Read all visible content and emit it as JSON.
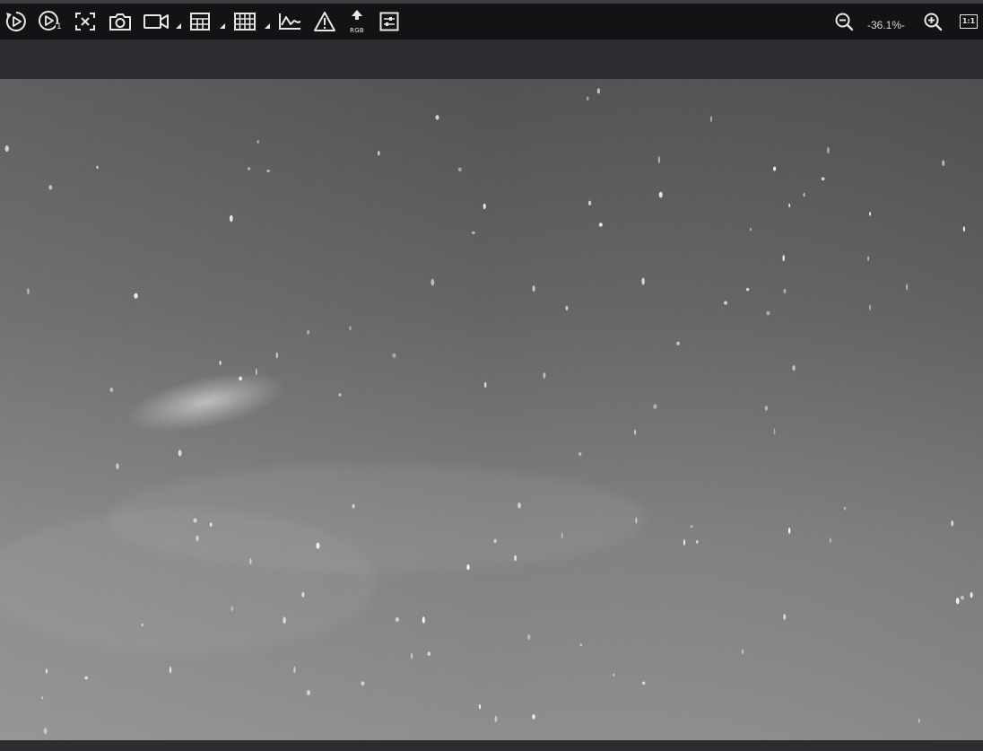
{
  "toolbar": {
    "tools": [
      {
        "name": "play-loop-icon"
      },
      {
        "name": "play-single-icon",
        "sub": "1"
      },
      {
        "name": "fit-view-icon"
      },
      {
        "name": "camera-snapshot-icon"
      },
      {
        "name": "video-record-icon"
      },
      {
        "name": "grid-small-icon"
      },
      {
        "name": "grid-large-icon"
      },
      {
        "name": "line-profile-icon"
      },
      {
        "name": "warning-icon"
      },
      {
        "name": "rgb-upload-icon",
        "label": "RGB"
      },
      {
        "name": "settings-sliders-icon"
      }
    ],
    "zoom_out_icon": "zoom-out-icon",
    "zoom_in_icon": "zoom-in-icon",
    "actual_size_label": "1:1",
    "zoom_level": "-36.1%-"
  },
  "colors": {
    "toolbar_bg": "#121314",
    "panel_bg": "#2b2d31",
    "icon": "#e8e8e8",
    "image_base": "#6a6a6a"
  }
}
